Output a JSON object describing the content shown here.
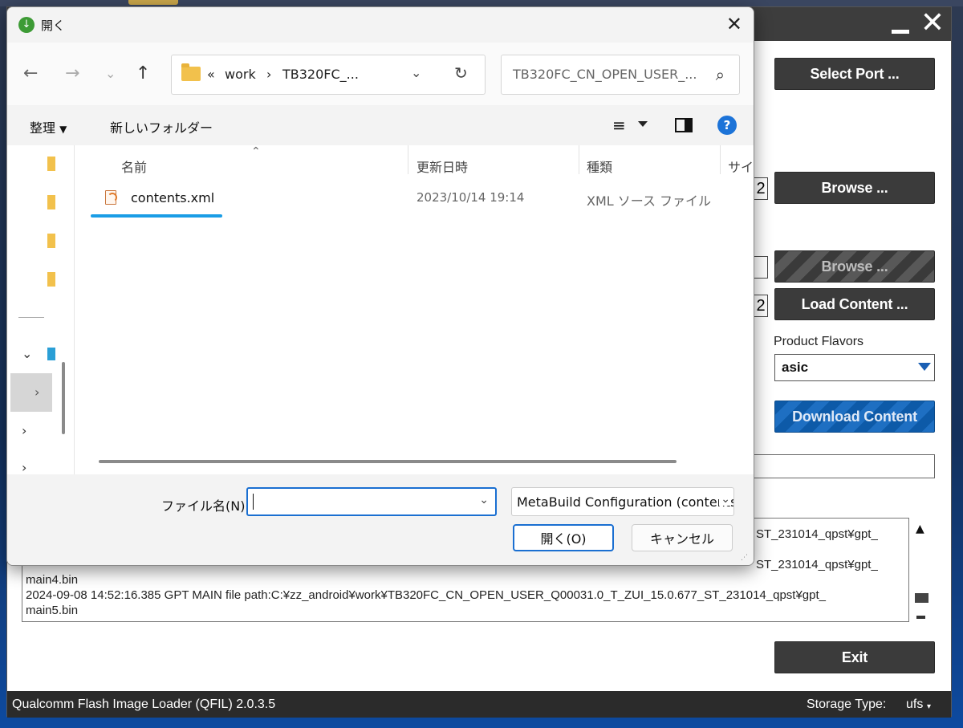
{
  "qfil": {
    "buttons": {
      "select_port": "Select Port ...",
      "browse_1": "Browse ...",
      "browse_2": "Browse ...",
      "load_content": "Load Content ...",
      "download_content": "Download Content",
      "exit": "Exit"
    },
    "side_box_digit": "2",
    "product_flavors_label": "Product Flavors",
    "product_flavor_selected": "asic",
    "log_lines": [
      "ST_231014_qpst¥gpt_",
      "ST_231014_qpst¥gpt_",
      "main4.bin",
      "2024-09-08 14:52:16.385    GPT MAIN file path:C:¥zz_android¥work¥TB320FC_CN_OPEN_USER_Q00031.0_T_ZUI_15.0.677_ST_231014_qpst¥gpt_",
      "main5.bin"
    ],
    "status_left": "Qualcomm Flash Image Loader (QFIL)   2.0.3.5",
    "storage_type_label": "Storage Type:",
    "storage_type_value": "ufs"
  },
  "dialog": {
    "title": "開く",
    "address": {
      "overflow": "«",
      "crumb_1": "work",
      "sep": "›",
      "crumb_2": "TB320FC_..."
    },
    "search_placeholder": "TB320FC_CN_OPEN_USER_...",
    "toolbar": {
      "organize": "整理",
      "new_folder": "新しいフォルダー"
    },
    "columns": {
      "name": "名前",
      "modified": "更新日時",
      "type": "種類",
      "size": "サイズ"
    },
    "files": [
      {
        "name": "contents.xml",
        "modified": "2023/10/14 19:14",
        "type": "XML ソース ファイル"
      }
    ],
    "footer": {
      "filename_label": "ファイル名(N):",
      "filename_value": "",
      "filetype": "MetaBuild Configuration (contents.xml)",
      "open_button": "開く(O)",
      "cancel_button": "キャンセル"
    }
  },
  "colors": {
    "qfil_dark": "#3b3b3b",
    "accent_blue": "#1a6fd1",
    "underline_blue": "#1a9de6"
  }
}
